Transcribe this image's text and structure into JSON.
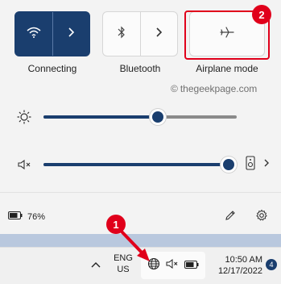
{
  "quick_settings": {
    "tiles": [
      {
        "label": "Connecting",
        "icon": "wifi-icon",
        "state": "on"
      },
      {
        "label": "Bluetooth",
        "icon": "bluetooth-icon",
        "state": "off"
      },
      {
        "label": "Airplane mode",
        "icon": "airplane-icon",
        "state": "off"
      }
    ],
    "brightness": {
      "icon": "brightness-icon",
      "level": 0.59
    },
    "volume": {
      "icon": "volume-muted-icon",
      "level": 1.0,
      "output_icon": "speaker-device-icon"
    },
    "battery": {
      "text": "76%",
      "icon": "battery-icon"
    },
    "edit_icon": "pencil-icon",
    "settings_icon": "gear-icon"
  },
  "watermark": {
    "text": "thegeekpage.com",
    "symbol": "©"
  },
  "annotations": {
    "badge_1": "1",
    "badge_2": "2",
    "color": "#e0001b"
  },
  "taskbar": {
    "chevron_icon": "chevron-up-icon",
    "lang_line1": "ENG",
    "lang_line2": "US",
    "time": "10:50 AM",
    "date": "12/17/2022",
    "notification_count": "4",
    "system_icons": [
      "globe-network-icon",
      "volume-muted-icon",
      "battery-icon"
    ]
  },
  "colors": {
    "accent": "#1a3e6e",
    "highlight_red": "#e0001b",
    "desktop": "#b9c8de"
  }
}
